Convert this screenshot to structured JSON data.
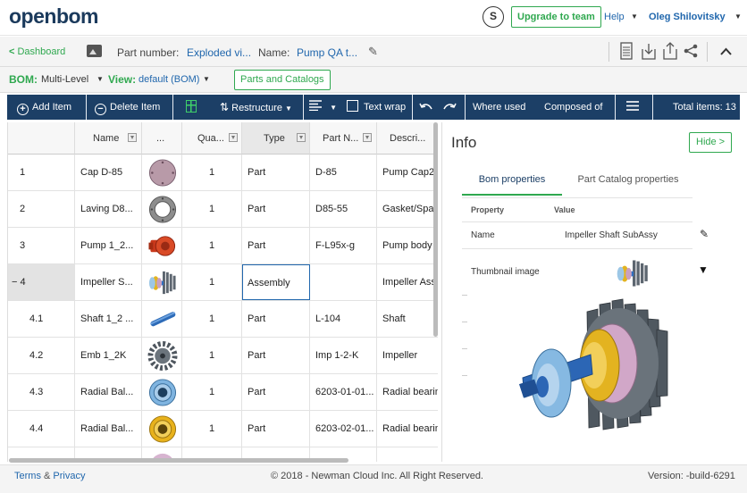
{
  "app": {
    "logo": "openbom",
    "avatar_initial": "S",
    "upgrade_label": "Upgrade to team",
    "help_label": "Help",
    "user_name": "Oleg Shilovitsky"
  },
  "header": {
    "back_label": "Dashboard",
    "part_number_label": "Part number:",
    "part_number_value": "Exploded vi...",
    "name_label": "Name:",
    "name_value": "Pump QA t..."
  },
  "bom_bar": {
    "bom_label": "BOM:",
    "bom_value": "Multi-Level",
    "view_label": "View:",
    "view_value": "default (BOM)",
    "parts_catalogs_label": "Parts and Catalogs"
  },
  "toolbar": {
    "add_item": "Add Item",
    "delete_item": "Delete Item",
    "restructure": "Restructure",
    "text_wrap": "Text wrap",
    "where_used": "Where used",
    "composed_of": "Composed of",
    "total_items": "Total items: 13"
  },
  "grid": {
    "columns": [
      "Name",
      "...",
      "Qua...",
      "Type",
      "Part N...",
      "Descri..."
    ],
    "rows": [
      {
        "num": "1",
        "name": "Cap D-85",
        "qty": "1",
        "type": "Part",
        "part_number": "D-85",
        "description": "Pump Cap2",
        "thumb": "disc-mauve"
      },
      {
        "num": "2",
        "name": "Laving D8...",
        "qty": "1",
        "type": "Part",
        "part_number": "D85-55",
        "description": "Gasket/Spa...",
        "thumb": "ring-gray"
      },
      {
        "num": "3",
        "name": "Pump 1_2...",
        "qty": "1",
        "type": "Part",
        "part_number": "F-L95x-g",
        "description": "Pump body",
        "thumb": "pump-red"
      },
      {
        "num": "− 4",
        "name": "Impeller S...",
        "qty": "1",
        "type": "Assembly",
        "part_number": "",
        "description": "Impeller Assy",
        "thumb": "assembly"
      },
      {
        "num": "4.1",
        "name": "Shaft 1_2 ...",
        "qty": "1",
        "type": "Part",
        "part_number": "L-104",
        "description": "Shaft",
        "thumb": "shaft-blue"
      },
      {
        "num": "4.2",
        "name": "Emb 1_2K",
        "qty": "1",
        "type": "Part",
        "part_number": "Imp 1-2-K",
        "description": "Impeller",
        "thumb": "gear-gray"
      },
      {
        "num": "4.3",
        "name": "Radial Bal...",
        "qty": "1",
        "type": "Part",
        "part_number": "6203-01-01...",
        "description": "Radial bearin",
        "thumb": "bearing-blue"
      },
      {
        "num": "4.4",
        "name": "Radial Bal...",
        "qty": "1",
        "type": "Part",
        "part_number": "6203-02-01...",
        "description": "Radial bearin",
        "thumb": "bearing-yellow"
      }
    ]
  },
  "info": {
    "title": "Info",
    "hide_label": "Hide >",
    "tab_bom": "Bom properties",
    "tab_catalog": "Part Catalog properties",
    "col_property": "Property",
    "col_value": "Value",
    "name_prop": "Name",
    "name_val": "Impeller Shaft SubAssy",
    "thumb_prop": "Thumbnail image"
  },
  "footer": {
    "terms": "Terms",
    "amp": "&",
    "privacy": "Privacy",
    "copyright": "© 2018 - Newman Cloud Inc. All Right Reserved.",
    "version": "Version: -build-6291"
  },
  "colors": {
    "brand_navy": "#1c3f66",
    "accent_green": "#2fa84f",
    "link_blue": "#2167ad"
  }
}
